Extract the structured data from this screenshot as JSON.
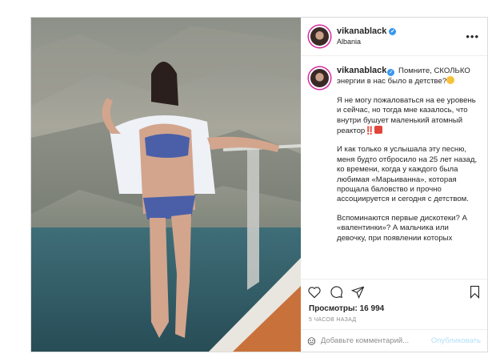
{
  "post": {
    "username": "vikanablack",
    "location": "Albania",
    "more_icon": "ellipsis-icon",
    "caption": {
      "username": "vikanablack",
      "lines": [
        "Помните, СКОЛЬКО энергии в нас было в детстве?",
        "Я не могу пожаловаться на ее уровень и сейчас, но тогда мне казалось, что внутри бушует маленький атомный реактор‼️",
        "И как только я услышала эту песню, меня будто отбросило на 25 лет назад, ко времени, когда у каждого была любимая «Марьиванна», которая прощала баловство и прочно ассоциируется и сегодня с детством.",
        "Вспоминаются первые дискотеки? А «валентинки»? А мальчика или девочку, при появлении которых"
      ]
    },
    "views_label": "Просмотры: 16 994",
    "time_ago": "5 ЧАСОВ НАЗАД",
    "comment_placeholder": "Добавьте комментарий...",
    "publish_label": "Опубликовать",
    "colors": {
      "verified": "#3897f0",
      "publish": "#b2dffc",
      "story_ring": "#d6249f"
    }
  }
}
